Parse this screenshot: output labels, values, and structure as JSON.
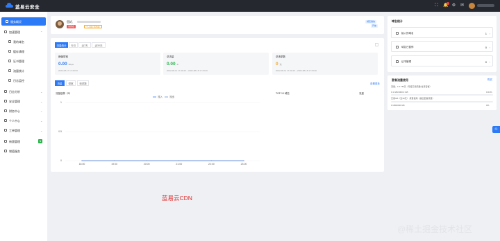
{
  "header": {
    "brand": "蓝易云安全"
  },
  "sidebar": {
    "items": [
      {
        "label": "服务概况"
      },
      {
        "label": "加速管理"
      },
      {
        "label": "我的域名"
      },
      {
        "label": "缓存清理"
      },
      {
        "label": "证书管理"
      },
      {
        "label": "流量统计"
      },
      {
        "label": "日志监控"
      },
      {
        "label": "日志分析"
      },
      {
        "label": "安全管理"
      },
      {
        "label": "财务中心"
      },
      {
        "label": "个人中心"
      },
      {
        "label": "工单管理"
      },
      {
        "label": "新版管理"
      },
      {
        "label": "增值服务"
      }
    ],
    "new_badge": "N"
  },
  "profile": {
    "name": "您好,",
    "tag_red": "未实名",
    "tag_orange": "个人版/ 高防版",
    "tag_blue": "绑定微信",
    "tag_blue2": "开放"
  },
  "tabs": [
    "流量统计",
    "今日",
    "近7天",
    "近30天"
  ],
  "stats": [
    {
      "title": "峰值带宽",
      "value": "0.00",
      "unit": "Mbps",
      "date": "2022-08-17 17:29:00",
      "color": "#2d7af6"
    },
    {
      "title": "总流量",
      "value": "0.00",
      "unit": "B",
      "date": "2022-08-11 17:43:46 ~ 2022-08-18 17:43:46",
      "color": "#29b34a"
    },
    {
      "title": "总请求数",
      "value": "0",
      "unit": "次",
      "date": "2022-08-11 17:43:46 ~ 2022-08-18 17:43:46",
      "color": "#f5a623"
    }
  ],
  "chart_tabs": [
    "流量",
    "带宽",
    "请求数"
  ],
  "chart_more": "查看更多",
  "chart": {
    "title": "流量趋势（B）",
    "top10": "TOP 10 域名",
    "top10_col": "流量"
  },
  "chart_data": {
    "type": "line",
    "x": [
      "18:00",
      "19:00",
      "20:00",
      "21:00",
      "22:00",
      "23:00"
    ],
    "series": [
      {
        "name": "流入",
        "values": [
          0,
          0,
          0,
          0,
          0,
          0
        ]
      },
      {
        "name": "流出",
        "values": [
          0,
          0,
          0,
          0,
          0,
          0
        ]
      }
    ],
    "yticks": [
      "1",
      "0.5",
      "0"
    ],
    "ylim": [
      0,
      1
    ],
    "grid": true,
    "legend": "top"
  },
  "domain_stats": {
    "title": "域名统计",
    "rows": [
      {
        "label": "接入的域名",
        "value": "1",
        "arrow": "›"
      },
      {
        "label": "域名已暂停",
        "value": "0",
        "arrow": "›"
      },
      {
        "label": "证书管理",
        "value": "0",
        "arrow": "›"
      }
    ]
  },
  "usage": {
    "title": "套餐流量使用",
    "link": "购买",
    "lines": [
      {
        "label": "流量：1.0 TB/天（月度已用流量/当月套餐）",
        "pct": ""
      },
      {
        "label": "0.1 GB/1000.0 GB",
        "pct": "0.01%"
      },
      {
        "label": "已用GB（近30天）  按量使用（超出套餐流量）",
        "pct": ""
      },
      {
        "label": "0 GB/2000 GB",
        "pct": "0%"
      }
    ],
    "fills": [
      0.0001,
      0
    ]
  },
  "caption": "蓝易云CDN",
  "watermark": "@稀土掘金技术社区",
  "colors": {
    "accent": "#2d7af6",
    "topbar": "#25282e",
    "green": "#29b34a",
    "orange": "#f5a623",
    "red": "#f25b5b"
  }
}
